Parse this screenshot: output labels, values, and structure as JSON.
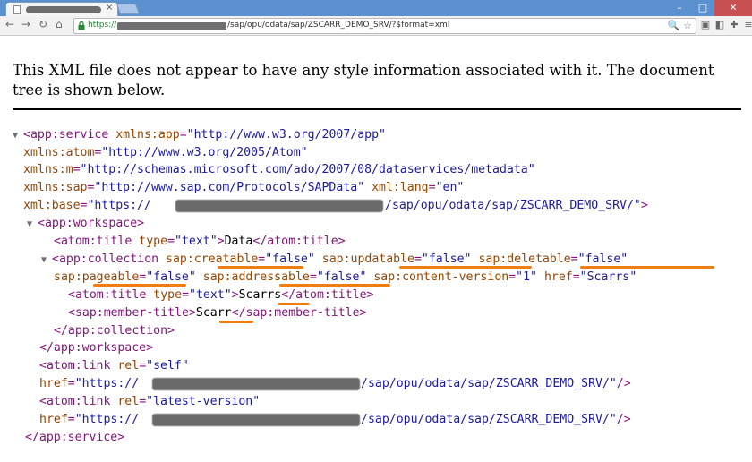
{
  "browser": {
    "window_controls": {
      "minimize": "–",
      "maximize": "□",
      "close": "✕"
    },
    "url_scheme": "https://",
    "url_path": "/sap/opu/odata/sap/ZSCARR_DEMO_SRV/?$format=xml",
    "icons": [
      "page-icon",
      "back-icon",
      "forward-icon",
      "reload-icon",
      "home-icon",
      "lock-icon",
      "zoom-icon",
      "star-icon",
      "extension-icons",
      "menu-icon"
    ]
  },
  "page": {
    "notice": "This XML file does not appear to have any style information associated with it. The document tree is shown below."
  },
  "xml": {
    "l1_open": "<app:service",
    "l1_attr": "xmlns:app",
    "l1_val": "\"http://www.w3.org/2007/app\"",
    "l2_attr": "xmlns:atom",
    "l2_val": "\"http://www.w3.org/2005/Atom\"",
    "l3_attr": "xmlns:m",
    "l3_val": "\"http://schemas.microsoft.com/ado/2007/08/dataservices/metadata\"",
    "l4_attr": "xmlns:sap",
    "l4_val": "\"http://www.sap.com/Protocols/SAPData\"",
    "l4_attr2": "xml:lang",
    "l4_val2": "\"en\"",
    "l5_attr": "xml:base",
    "l5_val_start": "\"https://",
    "l5_val_end": "/sap/opu/odata/sap/ZSCARR_DEMO_SRV/\"",
    "l6_open": "<app:workspace>",
    "l7_open": "<atom:title",
    "l7_attr": "type",
    "l7_val": "\"text\"",
    "l7_text": "Data",
    "l7_close": "</atom:title>",
    "l8_open": "<app:collection",
    "l8_a1": "sap:creatable",
    "l8_v1": "\"false\"",
    "l8_a2": "sap:updatable",
    "l8_v2": "\"false\"",
    "l8_a3": "sap:deletable",
    "l8_v3": "\"false\"",
    "l9_a1": "sap:pageable",
    "l9_v1": "\"false\"",
    "l9_a2": "sap:addressable",
    "l9_v2": "\"false\"",
    "l9_a3": "sap:content-version",
    "l9_v3": "\"1\"",
    "l9_a4": "href",
    "l9_v4": "\"Scarrs\"",
    "l10_open": "<atom:title",
    "l10_attr": "type",
    "l10_val": "\"text\"",
    "l10_text": "Scarrs",
    "l10_close": "</atom:title>",
    "l11_open": "<sap:member-title>",
    "l11_text": "Scarr",
    "l11_close": "</sap:member-title>",
    "l12_close": "</app:collection>",
    "l13_close": "</app:workspace>",
    "l14_open": "<atom:link",
    "l14_attr": "rel",
    "l14_val": "\"self\"",
    "l15_attr": "href",
    "l15_val_start": "\"https://",
    "l15_val_end": "/sap/opu/odata/sap/ZSCARR_DEMO_SRV/\"",
    "l15_close": "/>",
    "l16_open": "<atom:link",
    "l16_attr": "rel",
    "l16_val": "\"latest-version\"",
    "l17_attr": "href",
    "l17_val_start": "\"https://",
    "l17_val_end": "/sap/opu/odata/sap/ZSCARR_DEMO_SRV/\"",
    "l17_close": "/>",
    "l18_close": "</app:service>",
    "gt": ">",
    "eq": "=",
    "triangle": "▼"
  }
}
